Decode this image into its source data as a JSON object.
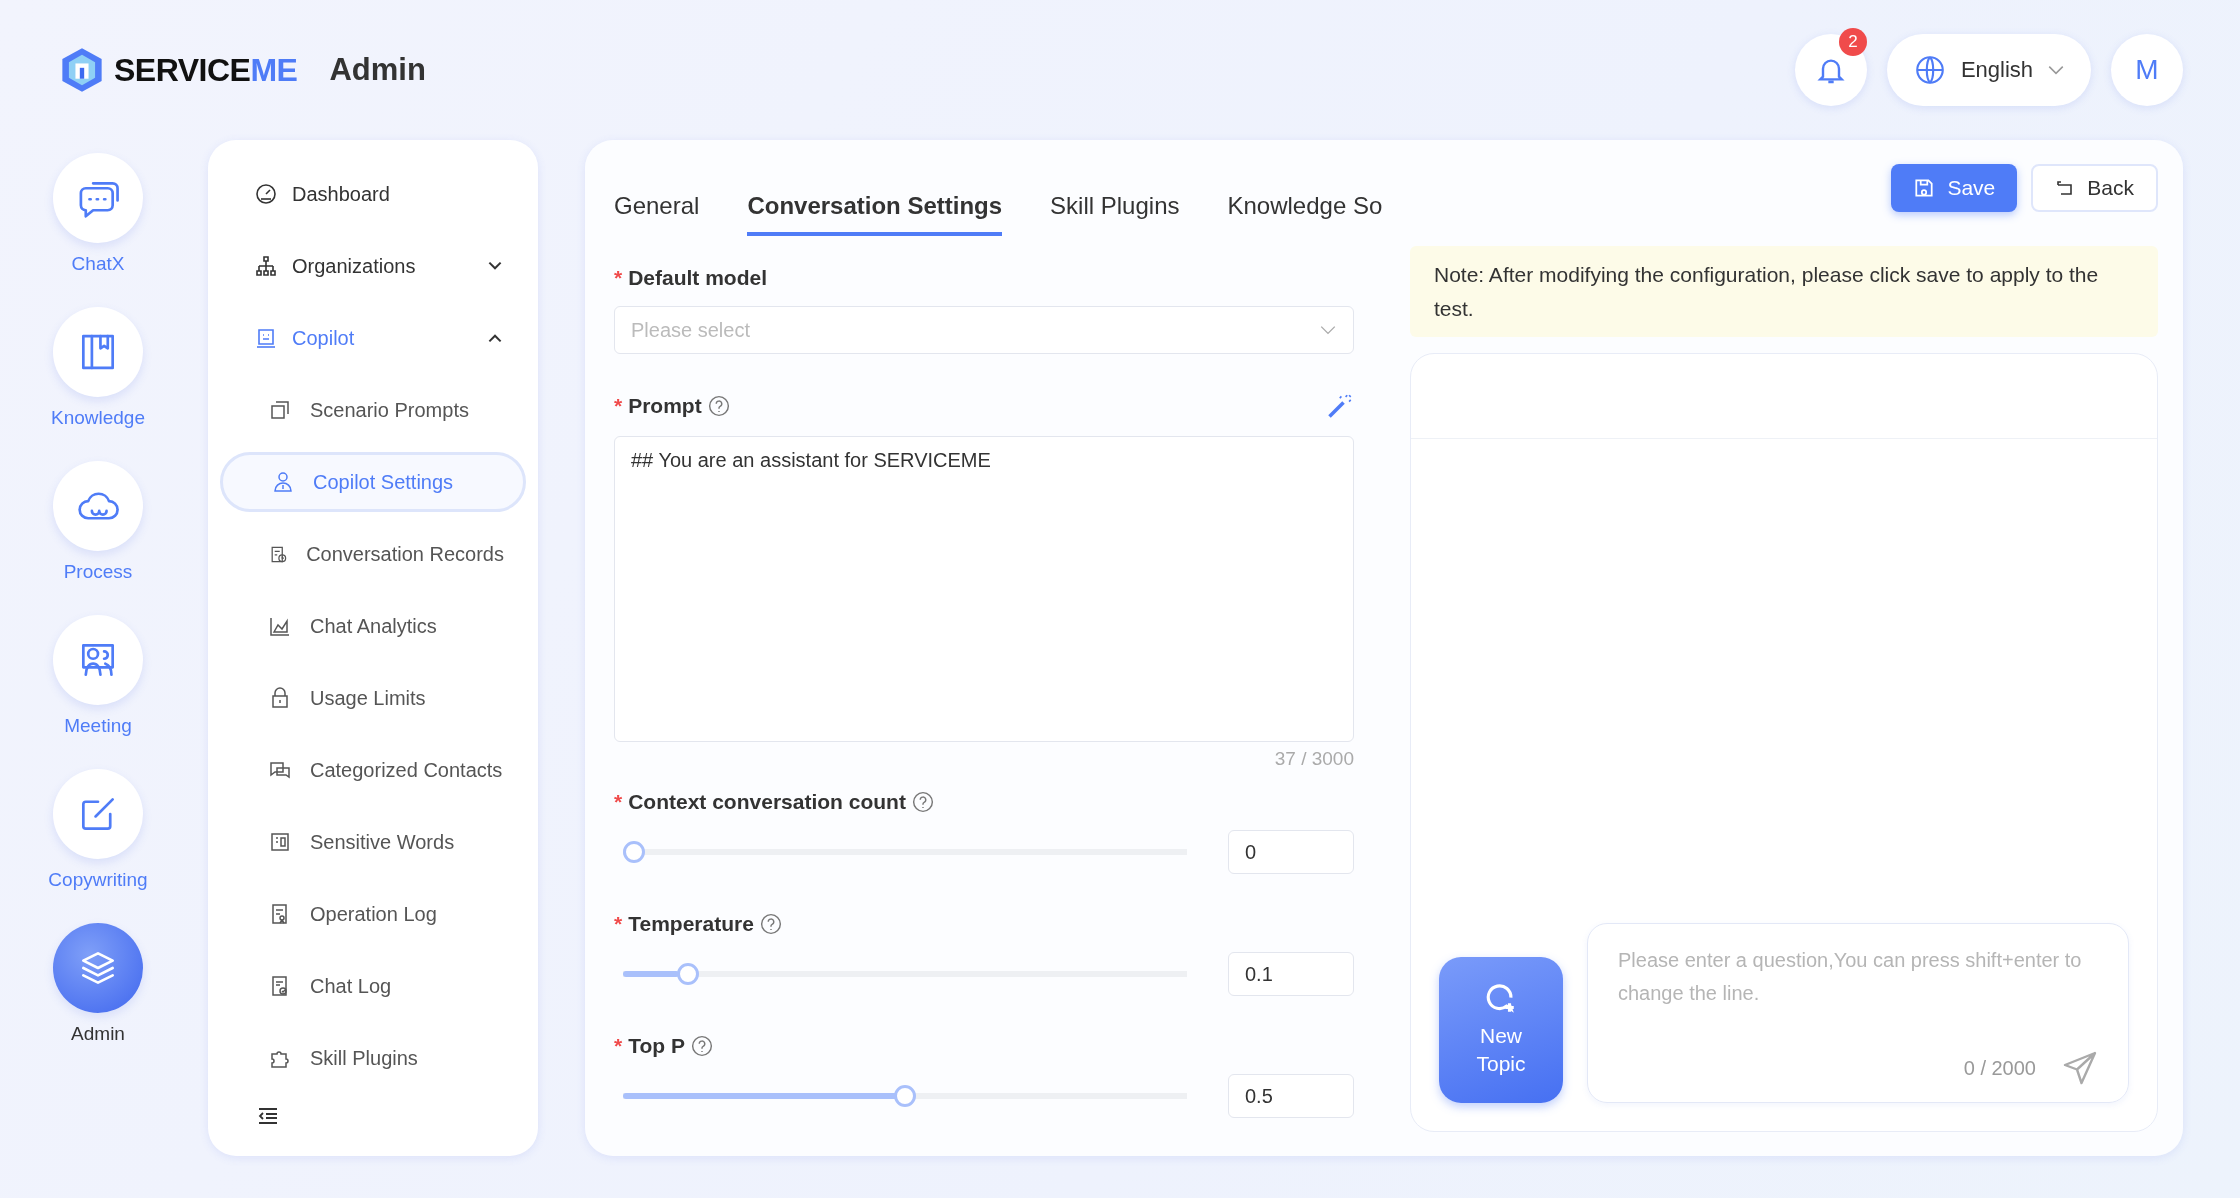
{
  "header": {
    "logo_main": "SERVICE",
    "logo_accent": "ME",
    "title": "Admin",
    "notification_count": "2",
    "language": "English",
    "avatar_initial": "M"
  },
  "rail": [
    {
      "label": "ChatX",
      "selected": false
    },
    {
      "label": "Knowledge",
      "selected": false
    },
    {
      "label": "Process",
      "selected": false
    },
    {
      "label": "Meeting",
      "selected": false
    },
    {
      "label": "Copywriting",
      "selected": false
    },
    {
      "label": "Admin",
      "selected": true
    }
  ],
  "menu": [
    {
      "label": "Dashboard",
      "selected": false
    },
    {
      "label": "Organizations",
      "selected": false,
      "expanded": false
    },
    {
      "label": "Copilot",
      "selected": true,
      "expanded": true,
      "children": [
        {
          "label": "Scenario Prompts",
          "selected": false
        },
        {
          "label": "Copilot Settings",
          "selected": true
        },
        {
          "label": "Conversation Records",
          "selected": false
        },
        {
          "label": "Chat Analytics",
          "selected": false
        },
        {
          "label": "Usage Limits",
          "selected": false
        },
        {
          "label": "Categorized Contacts",
          "selected": false
        },
        {
          "label": "Sensitive Words",
          "selected": false
        },
        {
          "label": "Operation Log",
          "selected": false
        },
        {
          "label": "Chat Log",
          "selected": false
        },
        {
          "label": "Skill Plugins",
          "selected": false
        }
      ]
    }
  ],
  "tabs": [
    {
      "label": "General",
      "selected": false
    },
    {
      "label": "Conversation Settings",
      "selected": true
    },
    {
      "label": "Skill Plugins",
      "selected": false
    },
    {
      "label": "Knowledge So",
      "selected": false
    }
  ],
  "actions": {
    "save": "Save",
    "back": "Back"
  },
  "fields": [
    {
      "kind": "select",
      "label": "Default model",
      "required_mark": "*",
      "help": false,
      "placeholder": "Please select"
    },
    {
      "kind": "textarea",
      "label": "Prompt",
      "required_mark": "*",
      "help": true,
      "value": "## You are an assistant for SERVICEME",
      "counter": "37 / 3000"
    },
    {
      "kind": "slider",
      "label": "Context conversation count",
      "required_mark": "*",
      "help": true,
      "level": 0,
      "value": "0"
    },
    {
      "kind": "slider",
      "label": "Temperature",
      "required_mark": "*",
      "help": true,
      "level": 0.1,
      "value": "0.1"
    },
    {
      "kind": "slider",
      "label": "Top P",
      "required_mark": "*",
      "help": true,
      "level": 0.5,
      "value": "0.5"
    }
  ],
  "note": "Note: After modifying the configuration, please click save to apply to the test.",
  "chat": {
    "new_topic": "New Topic",
    "placeholder": "Please enter a question,You can press shift+enter to change the line.",
    "counter": "0 / 2000"
  }
}
